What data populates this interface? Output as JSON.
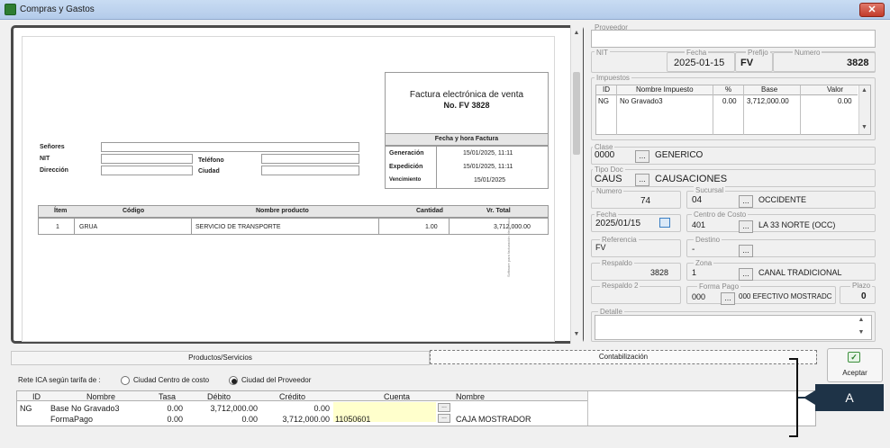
{
  "window": {
    "title": "Compras y Gastos",
    "close_glyph": "✕"
  },
  "invoice": {
    "title": "Factura electrónica de venta",
    "number": "No. FV 3828",
    "fecha_header": "Fecha y hora Factura",
    "generacion_label": "Generación",
    "generacion_value": "15/01/2025, 11:11",
    "expedicion_label": "Expedición",
    "expedicion_value": "15/01/2025, 11:11",
    "vencimiento_label": "Vencimiento",
    "vencimiento_value": "15/01/2025",
    "senores_label": "Señores",
    "nit_label": "NIT",
    "direccion_label": "Dirección",
    "telefono_label": "Teléfono",
    "ciudad_label": "Ciudad",
    "columns": [
      "Ítem",
      "Código",
      "Nombre producto",
      "Cantidad",
      "Vr. Total"
    ],
    "rows": [
      {
        "item": "1",
        "codigo": "GRUA",
        "nombre": "SERVICIO DE TRANSPORTE",
        "cantidad": "1.00",
        "total": "3,712,000.00"
      }
    ],
    "side_text": "Software para facturación electrónica"
  },
  "proveedor": {
    "caption": "Proveedor",
    "nit_caption": "NIT",
    "fecha_caption": "Fecha",
    "fecha": "2025-01-15",
    "prefijo_caption": "Prefijo",
    "prefijo": "FV",
    "numero_caption": "Numero",
    "numero": "3828"
  },
  "impuestos": {
    "caption": "Impuestos",
    "columns": [
      "ID",
      "Nombre Impuesto",
      "%",
      "Base",
      "Valor"
    ],
    "rows": [
      {
        "id": "NG",
        "nombre": "No Gravado3",
        "pct": "0.00",
        "base": "3,712,000.00",
        "valor": "0.00"
      }
    ]
  },
  "clase": {
    "caption": "Clase",
    "code": "0000",
    "name": "GENERICO"
  },
  "tipo_doc": {
    "caption": "Tipo Doc",
    "code": "CAUS",
    "name": "CAUSACIONES"
  },
  "numero": {
    "caption": "Numero",
    "value": "74"
  },
  "sucursal": {
    "caption": "Sucursal",
    "code": "04",
    "name": "OCCIDENTE"
  },
  "fecha2": {
    "caption": "Fecha",
    "value": "2025/01/15"
  },
  "centro_costo": {
    "caption": "Centro de Costo",
    "code": "401",
    "name": "LA 33 NORTE (OCC)"
  },
  "referencia": {
    "caption": "Referencia",
    "value": "FV"
  },
  "destino": {
    "caption": "Destino",
    "value": "-"
  },
  "respaldo": {
    "caption": "Respaldo",
    "value": "3828"
  },
  "zona": {
    "caption": "Zona",
    "code": "1",
    "name": "CANAL TRADICIONAL"
  },
  "respaldo2": {
    "caption": "Respaldo 2",
    "value": ""
  },
  "forma_pago": {
    "caption": "Forma Pago",
    "code": "000",
    "name": "000 EFECTIVO MOSTRADC"
  },
  "plazo": {
    "caption": "Plazo",
    "value": "0"
  },
  "detalle": {
    "caption": "Detalle",
    "value": ""
  },
  "tabs": {
    "productos": "Productos/Servicios",
    "contabilizacion": "Contabilización"
  },
  "aceptar": {
    "label": "Aceptar"
  },
  "rete_ica": {
    "label": "Rete ICA según tarifa de :",
    "option1": "Ciudad Centro de costo",
    "option2": "Ciudad del Proveedor",
    "selected": "Ciudad del Proveedor"
  },
  "accounting": {
    "columns": [
      "ID",
      "Nombre",
      "Tasa",
      "Débito",
      "Crédito",
      "Cuenta",
      "Nombre"
    ],
    "rows": [
      {
        "id": "NG",
        "nombre": "Base No Gravado3",
        "tasa": "0.00",
        "debito": "3,712,000.00",
        "credito": "0.00",
        "cuenta": "",
        "cuenta_nombre": ""
      },
      {
        "id": "",
        "nombre": "FormaPago",
        "tasa": "0.00",
        "debito": "0.00",
        "credito": "3,712,000.00",
        "cuenta": "11050601",
        "cuenta_nombre": "CAJA MOSTRADOR"
      }
    ]
  },
  "annotation": {
    "label": "A"
  },
  "glyphs": {
    "dots": "...",
    "up": "▲",
    "down": "▼",
    "calendar": "calendar-icon",
    "check": "✓"
  },
  "colors": {
    "annotation_bg": "#1e3347",
    "cuenta_highlight": "#ffffcc",
    "close_red": "#c23b2b"
  }
}
